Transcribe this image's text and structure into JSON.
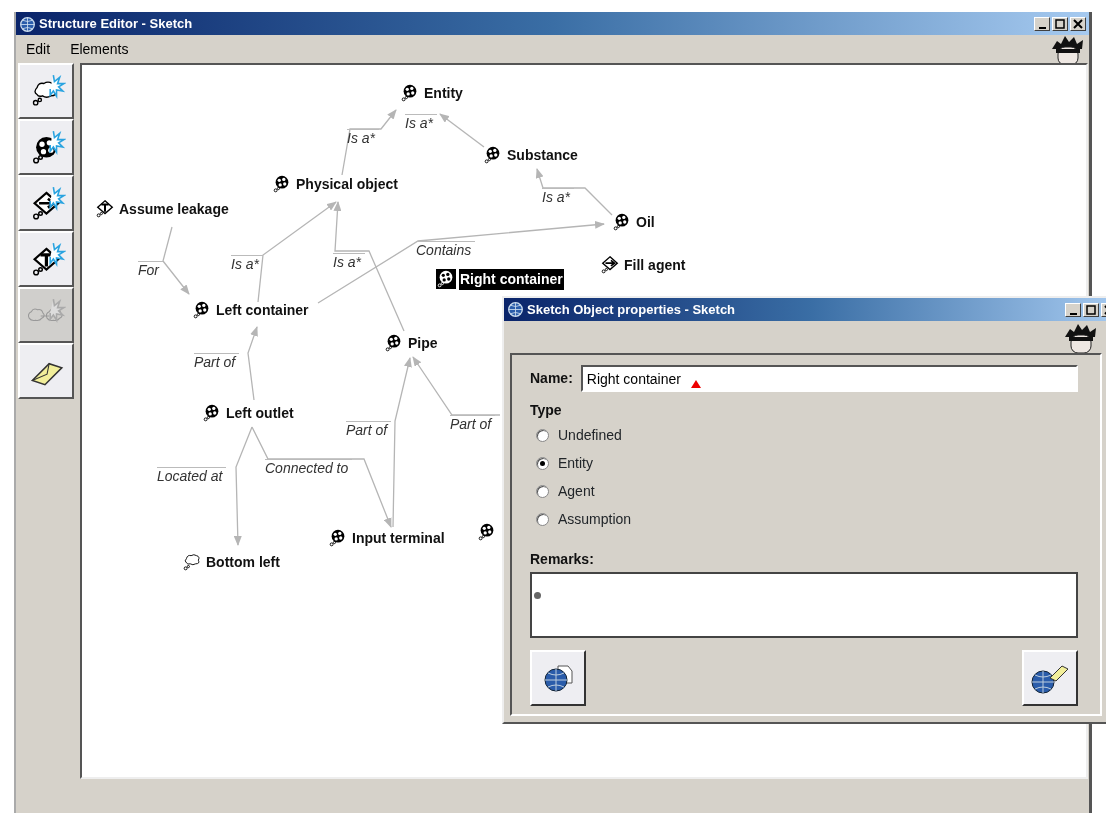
{
  "window": {
    "title": "Structure Editor - Sketch"
  },
  "menu": [
    {
      "label": "Edit"
    },
    {
      "label": "Elements"
    }
  ],
  "toolbar": [
    {
      "kind": "undefined",
      "disabled": false
    },
    {
      "kind": "entity",
      "disabled": false
    },
    {
      "kind": "agent",
      "disabled": false
    },
    {
      "kind": "assumption",
      "disabled": false
    },
    {
      "kind": "link",
      "disabled": true
    },
    {
      "kind": "eraser",
      "disabled": false
    }
  ],
  "nodes": [
    {
      "label": "Entity",
      "kind": "entity",
      "selected": false
    },
    {
      "label": "Substance",
      "kind": "entity",
      "selected": false
    },
    {
      "label": "Physical object",
      "kind": "entity",
      "selected": false
    },
    {
      "label": "Assume leakage",
      "kind": "assumption",
      "selected": false
    },
    {
      "label": "Oil",
      "kind": "entity",
      "selected": false
    },
    {
      "label": "Fill agent",
      "kind": "agent",
      "selected": false
    },
    {
      "label": "Right container",
      "kind": "entity",
      "selected": true
    },
    {
      "label": "Left container",
      "kind": "entity",
      "selected": false
    },
    {
      "label": "Pipe",
      "kind": "entity",
      "selected": false
    },
    {
      "label": "Left outlet",
      "kind": "entity",
      "selected": false
    },
    {
      "label": "Input terminal",
      "kind": "entity",
      "selected": false
    },
    {
      "label": "Bottom left",
      "kind": "undefined",
      "selected": false
    },
    {
      "kind": "entity",
      "selected": false
    }
  ],
  "edges": [
    {
      "label": "For"
    },
    {
      "label": "Is a*"
    },
    {
      "label": "Is a*"
    },
    {
      "label": "Is a*"
    },
    {
      "label": "Is a*"
    },
    {
      "label": "Is a*"
    },
    {
      "label": "Contains"
    },
    {
      "label": "Part of"
    },
    {
      "label": "Located at"
    },
    {
      "label": "Connected to"
    },
    {
      "label": "Part of"
    },
    {
      "label": "Part of"
    }
  ],
  "dialog": {
    "title": "Sketch Object properties - Sketch",
    "name_label": "Name:",
    "name_value": "Right container",
    "type_label": "Type",
    "types": [
      {
        "label": "Undefined",
        "selected": false
      },
      {
        "label": "Entity",
        "selected": true
      },
      {
        "label": "Agent",
        "selected": false
      },
      {
        "label": "Assumption",
        "selected": false
      }
    ],
    "remarks_label": "Remarks:"
  }
}
